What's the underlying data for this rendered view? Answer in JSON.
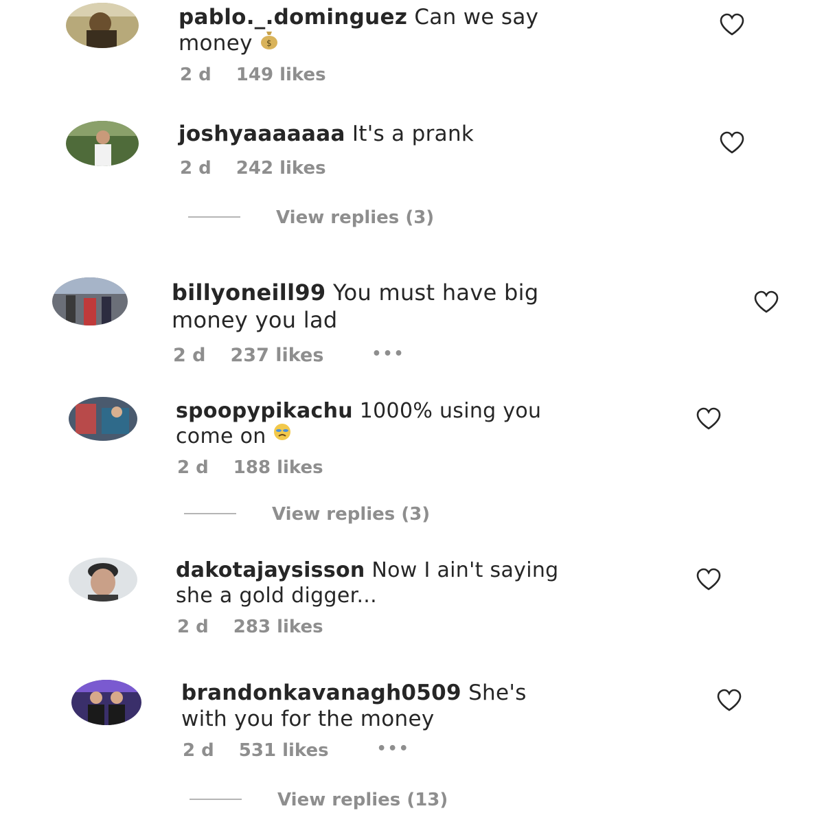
{
  "comments": [
    {
      "username": "pablo._.dominguez",
      "text": "Can we say",
      "text2": "money",
      "emoji": "money-bag",
      "time": "2 d",
      "likes": "149 likes"
    },
    {
      "username": "joshyaaaaaaa",
      "text": "It's a prank",
      "time": "2 d",
      "likes": "242 likes",
      "replies": "View replies (3)"
    },
    {
      "username": "billyoneill99",
      "text": "You must have big",
      "text2": "money you lad",
      "time": "2 d",
      "likes": "237 likes",
      "more": "•••"
    },
    {
      "username": "spoopypikachu",
      "text": "1000% using you",
      "text2": "come on",
      "emoji": "crying-face",
      "time": "2 d",
      "likes": "188 likes",
      "replies": "View replies (3)"
    },
    {
      "username": "dakotajaysisson",
      "text": "Now I ain't saying",
      "text2": "she a gold digger...",
      "time": "2 d",
      "likes": "283 likes"
    },
    {
      "username": "brandonkavanagh0509",
      "text": "She's",
      "text2": "with you for the money",
      "time": "2 d",
      "likes": "531 likes",
      "more": "•••",
      "replies": "View replies (13)"
    }
  ],
  "icons": {
    "like": "heart-outline-icon"
  },
  "colors": {
    "text": "#262626",
    "secondary": "#8e8e8e"
  }
}
